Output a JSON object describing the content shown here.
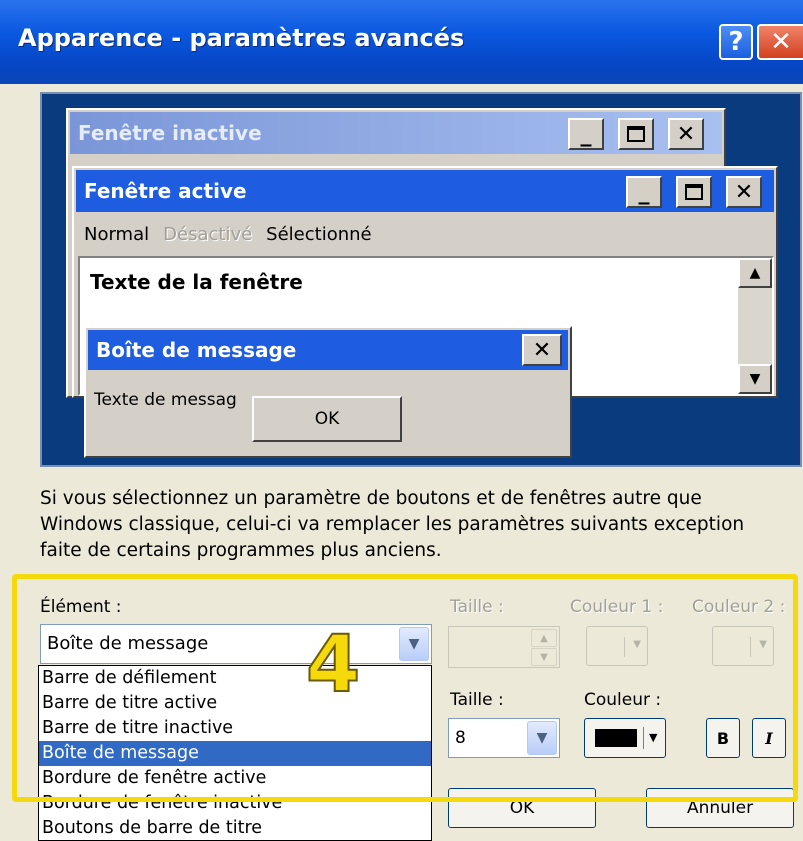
{
  "window": {
    "title": "Apparence - paramètres avancés",
    "help_label": "?",
    "close_label": "✕"
  },
  "preview": {
    "inactive_title": "Fenêtre inactive",
    "active_title": "Fenêtre active",
    "menu": [
      "Normal",
      "Désactivé",
      "Sélectionné"
    ],
    "window_text": "Texte de la fenêtre",
    "msgbox_title": "Boîte de message",
    "msgbox_text": "Texte de messag",
    "ok_label": "OK",
    "minimize_glyph": "_",
    "close_glyph": "✕"
  },
  "description": "Si vous sélectionnez un paramètre de boutons et de fenêtres autre que Windows classique, celui-ci va remplacer les paramètres suivants exception faite de certains programmes plus anciens.",
  "controls": {
    "element_label": "Élément :",
    "size_label_top": "Taille :",
    "color1_label": "Couleur 1 :",
    "color2_label": "Couleur 2 :",
    "element_value": "Boîte de message",
    "size_label_font": "Taille :",
    "color_label": "Couleur :",
    "size_value": "8",
    "bold_label": "B",
    "italic_label": "I",
    "ok_label": "OK",
    "cancel_label": "Annuler",
    "element_options": [
      "Barre de défilement",
      "Barre de titre active",
      "Barre de titre inactive",
      "Boîte de message",
      "Bordure de fenêtre active",
      "Bordure de fenêtre inactive",
      "Boutons de barre de titre"
    ],
    "selected_index": 3,
    "font_color": "#000000"
  },
  "annotation": {
    "step": "4",
    "color": "#f6d90a"
  }
}
